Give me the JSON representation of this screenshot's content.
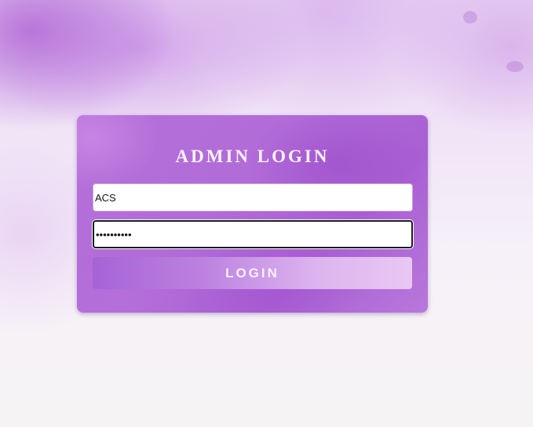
{
  "login": {
    "title": "ADMIN LOGIN",
    "username_value": "ACS",
    "password_value": "••••••••••",
    "button_label": "LOGIN"
  },
  "colors": {
    "card": "#b26cd8",
    "button_start": "#a563d6",
    "button_end": "#e8c8f3",
    "title_text": "#fbf3ff"
  }
}
